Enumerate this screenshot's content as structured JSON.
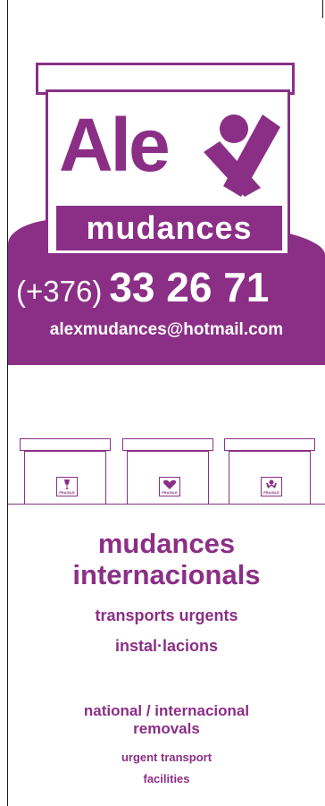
{
  "logo": {
    "word": "Ale",
    "sub": "mudances"
  },
  "contact": {
    "phone_prefix": "(+376)",
    "phone_number": "33 26 71",
    "email": "alexmudances@hotmail.com"
  },
  "boxes": [
    {
      "label": "FRAGILE",
      "icon": "glass-icon"
    },
    {
      "label": "FRAGILE",
      "icon": "heart-icon"
    },
    {
      "label": "FRAGILE",
      "icon": "hands-icon"
    }
  ],
  "services_ca": {
    "line1": "mudances",
    "line2": "internacionals",
    "line3": "transports urgents",
    "line4": "instal·lacions"
  },
  "services_en": {
    "line1": "national / internacional",
    "line2": "removals",
    "line3": "urgent transport",
    "line4": "facilities"
  },
  "colors": {
    "brand": "#8b2f86",
    "background": "#ffffff"
  }
}
